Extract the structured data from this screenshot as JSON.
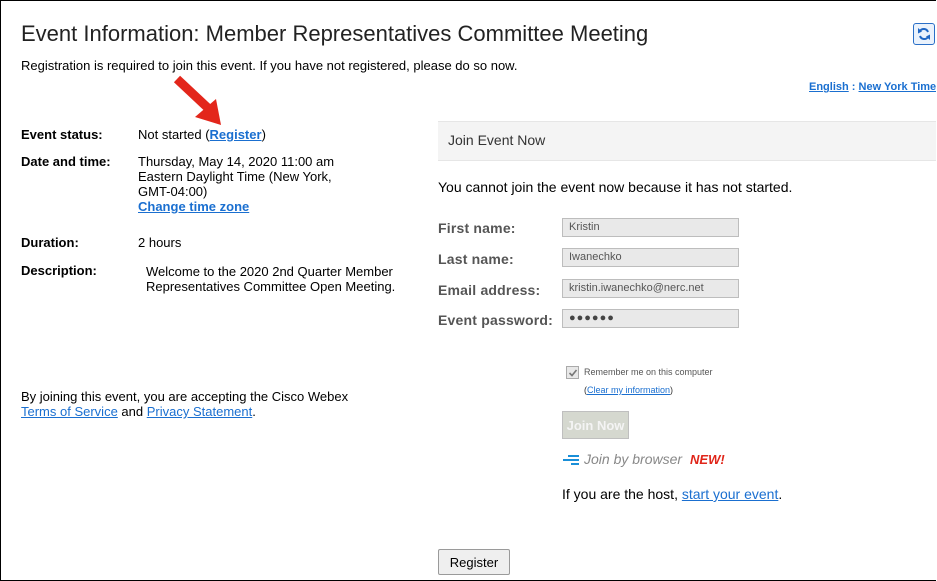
{
  "page": {
    "title": "Event Information: Member Representatives Committee Meeting",
    "registration_note": "Registration is required to join this event. If you have not registered, please do so now."
  },
  "language": {
    "language_label": "English",
    "separator": ":",
    "timezone_label": "New York Time"
  },
  "event": {
    "status_label": "Event status:",
    "status_value": "Not started (",
    "register_link": "Register",
    "status_close": ")",
    "datetime_label": "Date and time:",
    "datetime_line1": "Thursday, May 14, 2020 11:00 am",
    "datetime_line2": "Eastern Daylight Time (New York,",
    "datetime_line3": "GMT-04:00)",
    "change_tz": "Change time zone",
    "duration_label": "Duration:",
    "duration_value": "2 hours",
    "description_label": "Description:",
    "description_value": "Welcome to the 2020 2nd Quarter Member Representatives Committee Open Meeting."
  },
  "terms": {
    "prefix": "By joining this event, you are accepting the Cisco Webex ",
    "tos_link": "Terms of Service",
    "and": " and ",
    "privacy_link": "Privacy Statement",
    "suffix": "."
  },
  "join": {
    "header": "Join Event Now",
    "cannot_join": "You cannot join the event now because it has not started.",
    "first_name_label": "First name:",
    "first_name_value": "Kristin",
    "last_name_label": "Last name:",
    "last_name_value": "Iwanechko",
    "email_label": "Email address:",
    "email_value": "kristin.iwanechko@nerc.net",
    "password_label": "Event password:",
    "password_value": "●●●●●●",
    "remember_label": "Remember me on this computer",
    "clear_open": "(",
    "clear_link": "Clear my information",
    "clear_close": ")",
    "join_now_button": "Join Now",
    "join_browser": "Join by browser",
    "new_tag": "NEW!",
    "host_prefix": "If you are the host, ",
    "host_link": "start your event",
    "host_suffix": ".",
    "register_button": "Register"
  },
  "colors": {
    "link": "#1a6fd0",
    "new_tag": "#e0261a",
    "arrow": "#e3261b"
  }
}
